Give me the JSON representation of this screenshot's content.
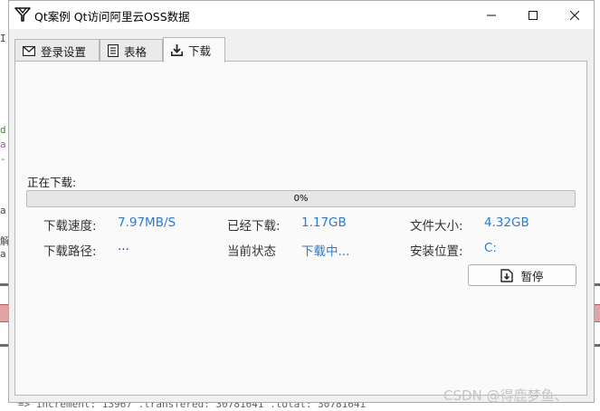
{
  "window": {
    "title": "Qt案例  Qt访问阿里云OSS数据"
  },
  "tabs": [
    {
      "label": "登录设置",
      "icon": "envelope-icon"
    },
    {
      "label": "表格",
      "icon": "table-icon"
    },
    {
      "label": "下载",
      "icon": "download-icon"
    }
  ],
  "download": {
    "status_label": "正在下载:",
    "progress_percent": 0,
    "progress_text": "0%",
    "speed_label": "下载速度:",
    "speed_value": "7.97MB/S",
    "downloaded_label": "已经下载:",
    "downloaded_value": "1.17GB",
    "filesize_label": "文件大小:",
    "filesize_value": "4.32GB",
    "path_label": "下载路径:",
    "path_value": "...",
    "state_label": "当前状态",
    "state_value": "下载中...",
    "install_label": "安装位置:",
    "install_value": "C:",
    "pause_label": "暂停"
  },
  "background": {
    "console_text": "=> increment: 13967 .transfered: 30781641 .total: 30781641",
    "watermark": "CSDN @得鹿梦鱼、"
  },
  "colors": {
    "accent_value": "#2c7bd2",
    "progress_fill": "#06b025"
  }
}
